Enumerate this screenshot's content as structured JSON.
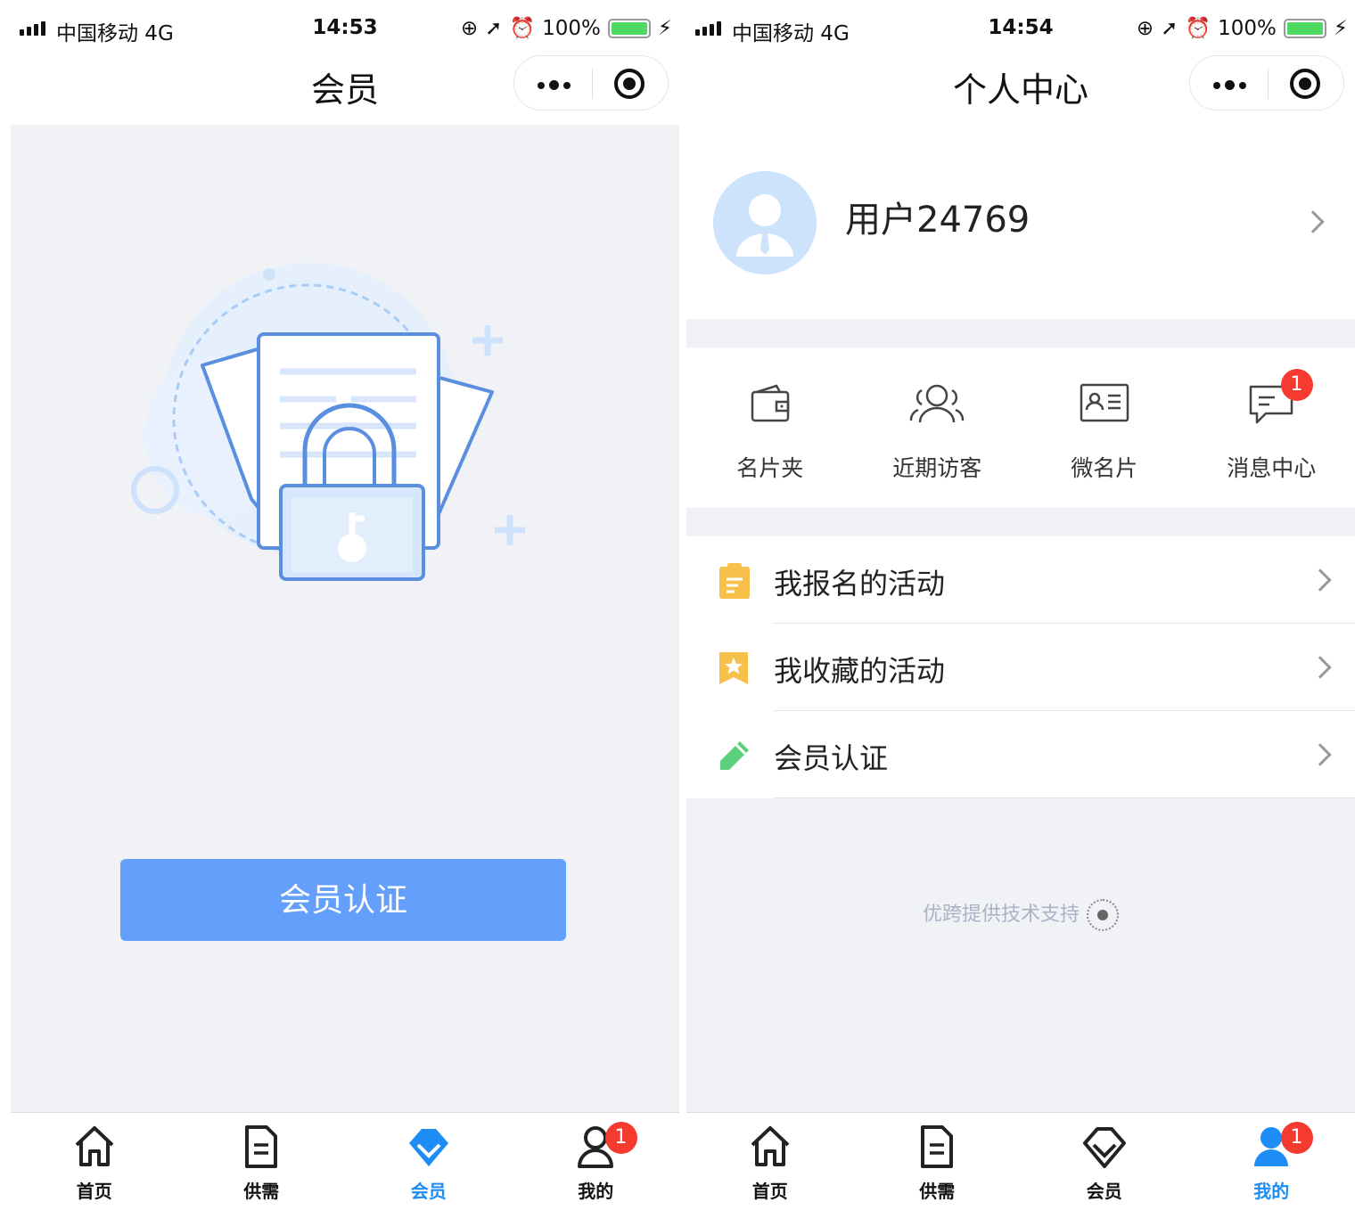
{
  "left": {
    "status": {
      "carrier": "中国移动  4G",
      "time": "14:53",
      "battery": "100%"
    },
    "title": "会员",
    "cta_label": "会员认证",
    "tabs": [
      {
        "label": "首页",
        "icon": "home-icon",
        "active": false
      },
      {
        "label": "供需",
        "icon": "document-icon",
        "active": false
      },
      {
        "label": "会员",
        "icon": "diamond-icon",
        "active": true
      },
      {
        "label": "我的",
        "icon": "user-icon",
        "active": false,
        "badge": "1"
      }
    ]
  },
  "right": {
    "status": {
      "carrier": "中国移动  4G",
      "time": "14:54",
      "battery": "100%"
    },
    "title": "个人中心",
    "username": "用户24769",
    "quick": [
      {
        "label": "名片夹",
        "icon": "wallet-icon"
      },
      {
        "label": "近期访客",
        "icon": "visitors-icon"
      },
      {
        "label": "微名片",
        "icon": "id-card-icon"
      },
      {
        "label": "消息中心",
        "icon": "message-icon",
        "badge": "1"
      }
    ],
    "menu": [
      {
        "label": "我报名的活动",
        "icon": "clipboard-icon",
        "color": "#f7c04a"
      },
      {
        "label": "我收藏的活动",
        "icon": "bookmark-star-icon",
        "color": "#f7c04a"
      },
      {
        "label": "会员认证",
        "icon": "pencil-icon",
        "color": "#5ccf7d"
      }
    ],
    "footer": "优跨提供技术支持",
    "tabs": [
      {
        "label": "首页",
        "icon": "home-icon",
        "active": false
      },
      {
        "label": "供需",
        "icon": "document-icon",
        "active": false
      },
      {
        "label": "会员",
        "icon": "diamond-icon",
        "active": false
      },
      {
        "label": "我的",
        "icon": "user-icon",
        "active": true,
        "badge": "1"
      }
    ]
  },
  "colors": {
    "accent": "#1e8cf5",
    "cta": "#649ffb",
    "badge": "#f53a2f",
    "bg": "#f1f2f6"
  }
}
